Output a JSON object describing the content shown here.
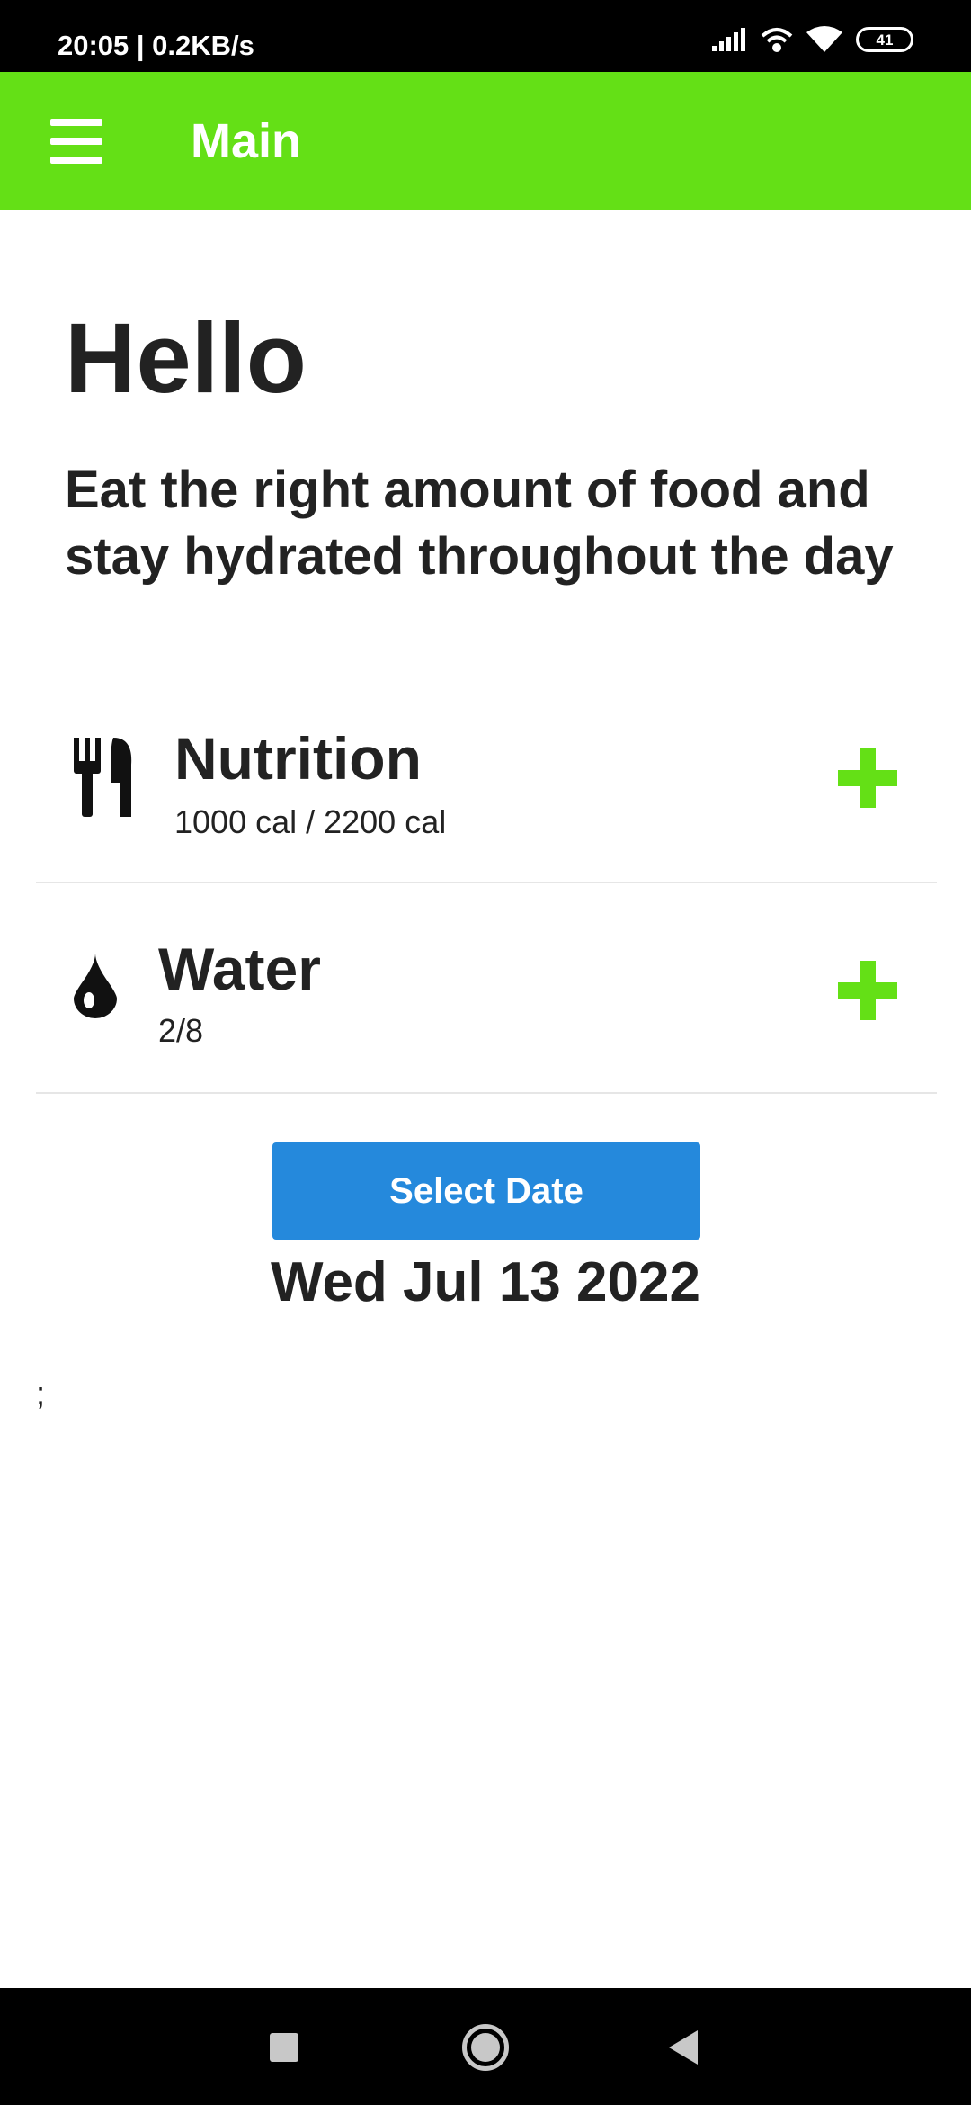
{
  "status_bar": {
    "time_speed": "20:05 | 0.2KB/s",
    "battery_level": "41",
    "icons": [
      "signal-icon",
      "wifi-calling-icon",
      "wifi-icon",
      "battery-icon"
    ]
  },
  "app_bar": {
    "title": "Main",
    "menu_icon": "hamburger-menu-icon",
    "background_color": "#64e016"
  },
  "main": {
    "greeting": "Hello",
    "subtitle": "Eat the right amount of food and stay hydrated throughout the day",
    "trackers": [
      {
        "icon": "cutlery-icon",
        "title": "Nutrition",
        "value": "1000 cal / 2200 cal",
        "add_icon": "plus-icon"
      },
      {
        "icon": "water-drop-icon",
        "title": "Water",
        "value": "2/8",
        "add_icon": "plus-icon"
      }
    ],
    "select_date_label": "Select Date",
    "selected_date": "Wed Jul 13 2022",
    "stray_text": ";",
    "accent_color": "#64e016",
    "button_color": "#2589dc"
  },
  "nav_bar": {
    "icons": [
      "recents-square-icon",
      "home-circle-icon",
      "back-triangle-icon"
    ]
  }
}
